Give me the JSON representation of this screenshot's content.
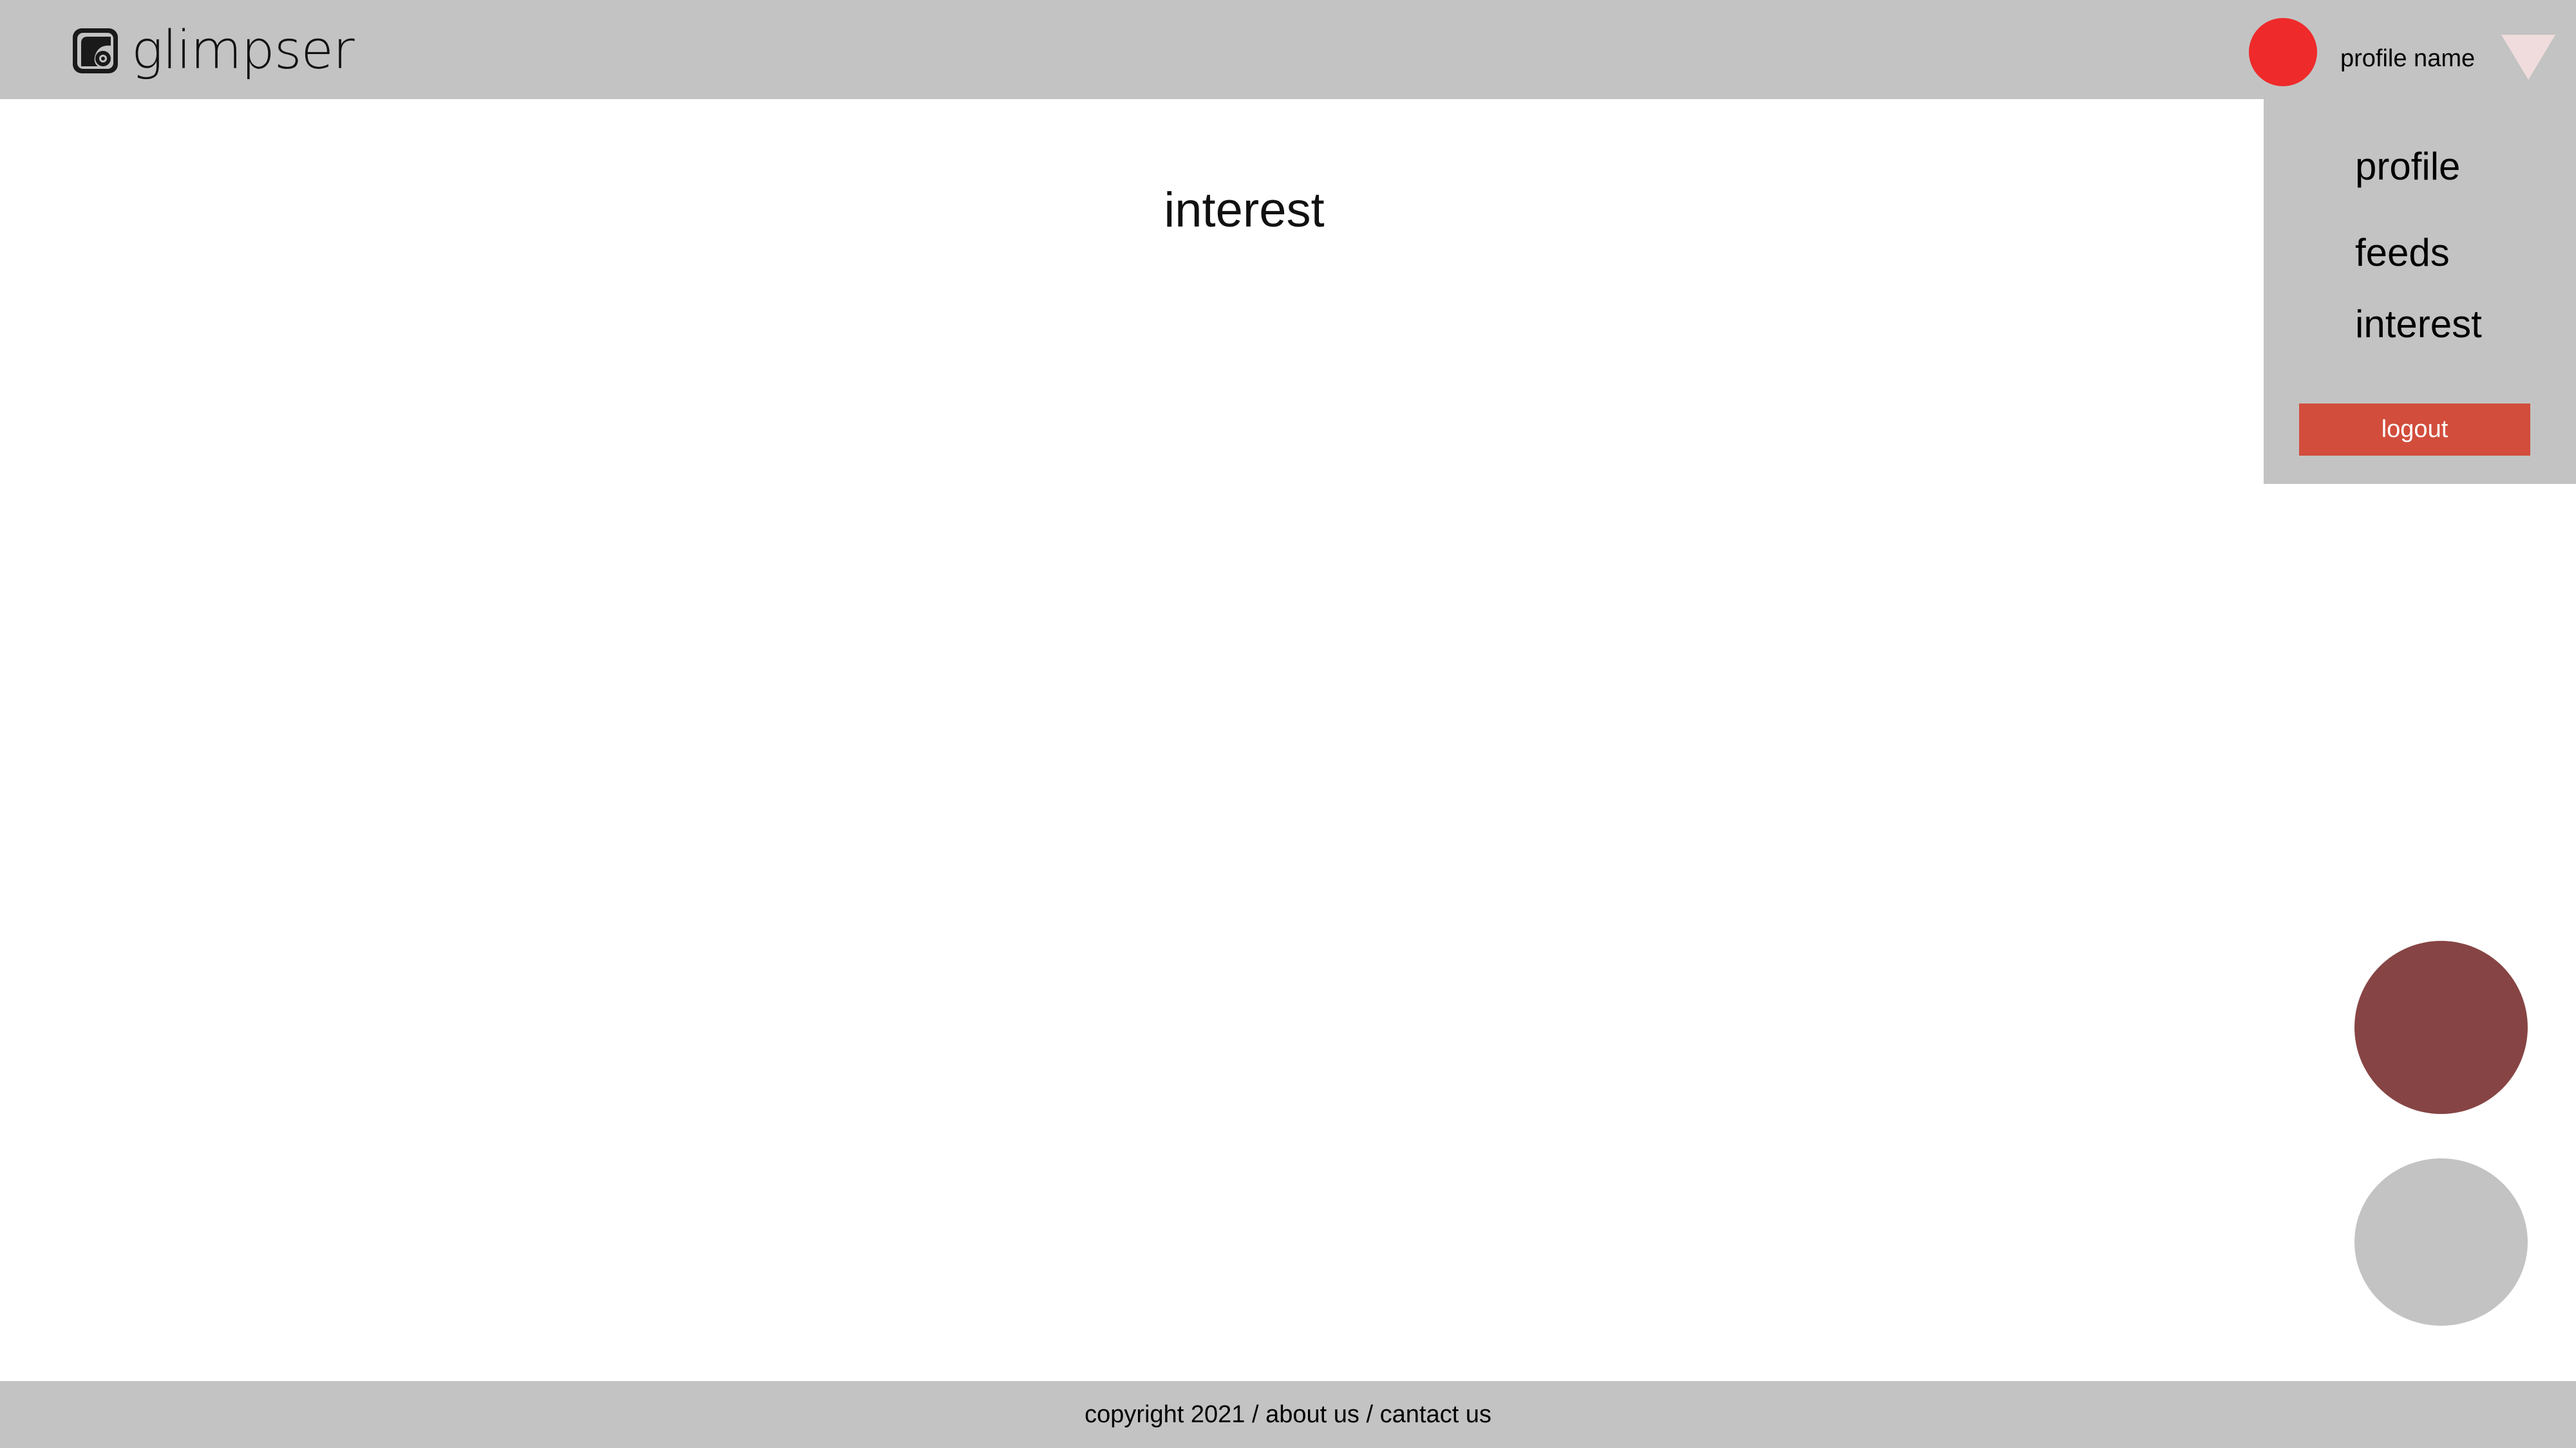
{
  "brand": {
    "name": "glimpser",
    "logo_icon": "camera-logo-icon"
  },
  "header": {
    "profile_name": "profile name",
    "avatar_color": "#ef2a2a",
    "dropdown_icon": "triangle-down-icon"
  },
  "menu": {
    "items": [
      {
        "label": "profile"
      },
      {
        "label": "feeds"
      },
      {
        "label": "interest"
      }
    ],
    "logout_label": "logout"
  },
  "main": {
    "title": "interest"
  },
  "fabs": {
    "primary_color": "#874444",
    "secondary_color": "#c3c3c3"
  },
  "footer": {
    "copyright": "copyright 2021",
    "separator": " / ",
    "about_label": "about us",
    "contact_label": "cantact us"
  },
  "colors": {
    "header_bg": "#c3c3c3",
    "logout_bg": "#d24d3c",
    "page_bg": "#ffffff"
  }
}
